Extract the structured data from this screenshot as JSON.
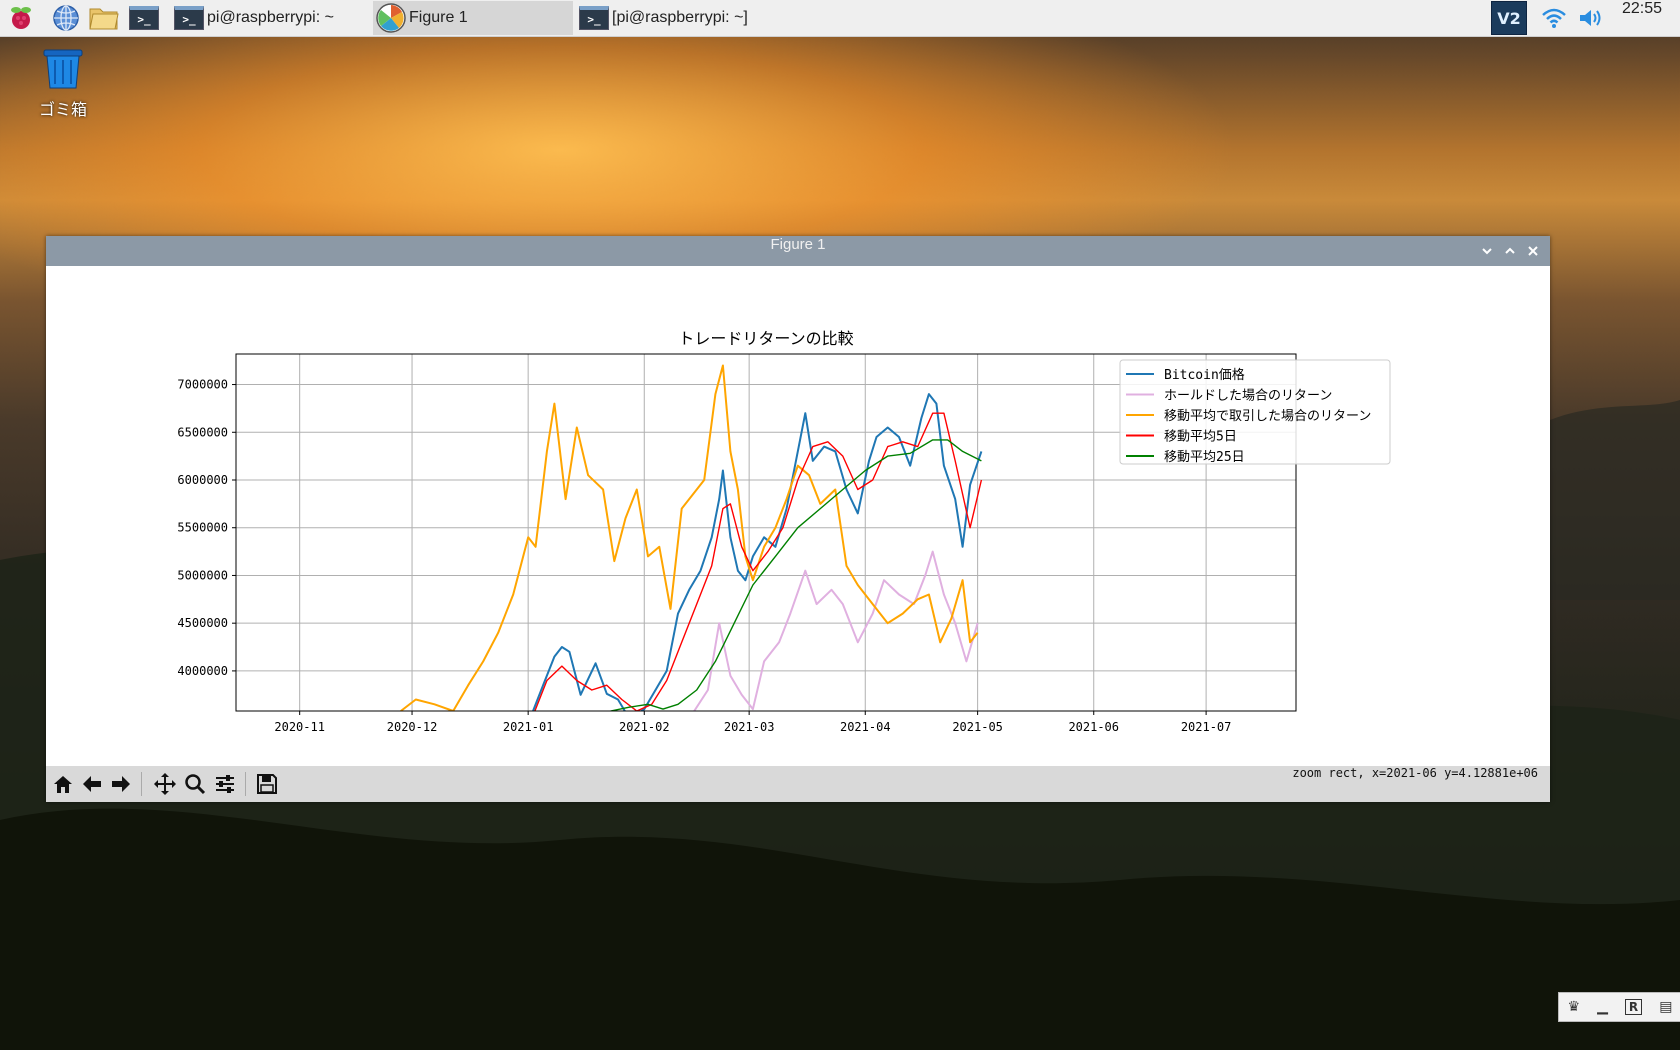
{
  "taskbar": {
    "tasks": [
      {
        "label": "pi@raspberrypi: ~"
      },
      {
        "label": "Figure 1"
      },
      {
        "label": "[pi@raspberrypi: ~]"
      }
    ],
    "clock": "22:55",
    "vnc_label": "V2"
  },
  "desktop": {
    "trash_label": "ゴミ箱"
  },
  "window": {
    "title": "Figure 1",
    "status_text": "zoom rect, x=2021-06 y=4.12881e+06"
  },
  "mini_tray": {
    "r_label": "R"
  },
  "chart_data": {
    "type": "line",
    "title": "トレードリターンの比較",
    "xlabel": "",
    "ylabel": "",
    "x_ticks": [
      "2020-11",
      "2020-12",
      "2021-01",
      "2021-02",
      "2021-03",
      "2021-04",
      "2021-05",
      "2021-06",
      "2021-07"
    ],
    "y_ticks": [
      "4000000",
      "4500000",
      "5000000",
      "5500000",
      "6000000",
      "6500000",
      "7000000"
    ],
    "ylim": [
      3580000,
      7320000
    ],
    "xlim": [
      "2020-10-15",
      "2021-07-25"
    ],
    "grid": true,
    "legend_position": "upper right",
    "series": [
      {
        "name": "Bitcoin価格",
        "color": "#1f77b4",
        "points": [
          [
            "2021-01-01",
            3450000
          ],
          [
            "2021-01-05",
            3850000
          ],
          [
            "2021-01-08",
            4150000
          ],
          [
            "2021-01-10",
            4250000
          ],
          [
            "2021-01-12",
            4200000
          ],
          [
            "2021-01-15",
            3750000
          ],
          [
            "2021-01-19",
            4080000
          ],
          [
            "2021-01-22",
            3760000
          ],
          [
            "2021-01-25",
            3700000
          ],
          [
            "2021-01-28",
            3500000
          ],
          [
            "2021-02-01",
            3600000
          ],
          [
            "2021-02-04",
            3800000
          ],
          [
            "2021-02-07",
            4000000
          ],
          [
            "2021-02-10",
            4600000
          ],
          [
            "2021-02-13",
            4850000
          ],
          [
            "2021-02-16",
            5050000
          ],
          [
            "2021-02-19",
            5400000
          ],
          [
            "2021-02-21",
            5800000
          ],
          [
            "2021-02-22",
            6100000
          ],
          [
            "2021-02-24",
            5400000
          ],
          [
            "2021-02-26",
            5050000
          ],
          [
            "2021-02-28",
            4950000
          ],
          [
            "2021-03-02",
            5200000
          ],
          [
            "2021-03-05",
            5400000
          ],
          [
            "2021-03-08",
            5300000
          ],
          [
            "2021-03-11",
            5700000
          ],
          [
            "2021-03-14",
            6300000
          ],
          [
            "2021-03-16",
            6700000
          ],
          [
            "2021-03-18",
            6200000
          ],
          [
            "2021-03-21",
            6350000
          ],
          [
            "2021-03-24",
            6300000
          ],
          [
            "2021-03-27",
            5900000
          ],
          [
            "2021-03-30",
            5650000
          ],
          [
            "2021-04-02",
            6200000
          ],
          [
            "2021-04-04",
            6450000
          ],
          [
            "2021-04-07",
            6550000
          ],
          [
            "2021-04-10",
            6450000
          ],
          [
            "2021-04-13",
            6150000
          ],
          [
            "2021-04-16",
            6650000
          ],
          [
            "2021-04-18",
            6900000
          ],
          [
            "2021-04-20",
            6800000
          ],
          [
            "2021-04-22",
            6150000
          ],
          [
            "2021-04-25",
            5800000
          ],
          [
            "2021-04-27",
            5300000
          ],
          [
            "2021-04-29",
            5950000
          ],
          [
            "2021-05-02",
            6300000
          ]
        ]
      },
      {
        "name": "ホールドした場合のリターン",
        "color": "#e0b0e0",
        "points": [
          [
            "2021-02-14",
            3560000
          ],
          [
            "2021-02-18",
            3800000
          ],
          [
            "2021-02-21",
            4500000
          ],
          [
            "2021-02-24",
            3950000
          ],
          [
            "2021-02-27",
            3750000
          ],
          [
            "2021-03-02",
            3600000
          ],
          [
            "2021-03-05",
            4100000
          ],
          [
            "2021-03-09",
            4300000
          ],
          [
            "2021-03-12",
            4600000
          ],
          [
            "2021-03-16",
            5050000
          ],
          [
            "2021-03-19",
            4700000
          ],
          [
            "2021-03-23",
            4850000
          ],
          [
            "2021-03-26",
            4700000
          ],
          [
            "2021-03-30",
            4300000
          ],
          [
            "2021-04-03",
            4600000
          ],
          [
            "2021-04-06",
            4950000
          ],
          [
            "2021-04-10",
            4800000
          ],
          [
            "2021-04-14",
            4700000
          ],
          [
            "2021-04-17",
            5000000
          ],
          [
            "2021-04-19",
            5250000
          ],
          [
            "2021-04-22",
            4800000
          ],
          [
            "2021-04-25",
            4500000
          ],
          [
            "2021-04-28",
            4100000
          ],
          [
            "2021-05-01",
            4500000
          ]
        ]
      },
      {
        "name": "移動平均で取引した場合のリターン",
        "color": "#ffa500",
        "points": [
          [
            "2020-11-28",
            3580000
          ],
          [
            "2020-12-02",
            3700000
          ],
          [
            "2020-12-07",
            3650000
          ],
          [
            "2020-12-12",
            3580000
          ],
          [
            "2020-12-16",
            3850000
          ],
          [
            "2020-12-20",
            4100000
          ],
          [
            "2020-12-24",
            4400000
          ],
          [
            "2020-12-28",
            4800000
          ],
          [
            "2021-01-01",
            5400000
          ],
          [
            "2021-01-03",
            5300000
          ],
          [
            "2021-01-06",
            6300000
          ],
          [
            "2021-01-08",
            6800000
          ],
          [
            "2021-01-11",
            5800000
          ],
          [
            "2021-01-14",
            6550000
          ],
          [
            "2021-01-17",
            6050000
          ],
          [
            "2021-01-21",
            5900000
          ],
          [
            "2021-01-24",
            5150000
          ],
          [
            "2021-01-27",
            5600000
          ],
          [
            "2021-01-30",
            5900000
          ],
          [
            "2021-02-02",
            5200000
          ],
          [
            "2021-02-05",
            5300000
          ],
          [
            "2021-02-08",
            4650000
          ],
          [
            "2021-02-11",
            5700000
          ],
          [
            "2021-02-14",
            5850000
          ],
          [
            "2021-02-17",
            6000000
          ],
          [
            "2021-02-20",
            6900000
          ],
          [
            "2021-02-22",
            7200000
          ],
          [
            "2021-02-24",
            6300000
          ],
          [
            "2021-02-26",
            5900000
          ],
          [
            "2021-02-28",
            5200000
          ],
          [
            "2021-03-02",
            4950000
          ],
          [
            "2021-03-05",
            5300000
          ],
          [
            "2021-03-08",
            5500000
          ],
          [
            "2021-03-11",
            5800000
          ],
          [
            "2021-03-14",
            6150000
          ],
          [
            "2021-03-17",
            6050000
          ],
          [
            "2021-03-20",
            5750000
          ],
          [
            "2021-03-24",
            5900000
          ],
          [
            "2021-03-27",
            5100000
          ],
          [
            "2021-03-30",
            4900000
          ],
          [
            "2021-04-03",
            4700000
          ],
          [
            "2021-04-07",
            4500000
          ],
          [
            "2021-04-11",
            4600000
          ],
          [
            "2021-04-15",
            4750000
          ],
          [
            "2021-04-18",
            4800000
          ],
          [
            "2021-04-21",
            4300000
          ],
          [
            "2021-04-24",
            4550000
          ],
          [
            "2021-04-27",
            4950000
          ],
          [
            "2021-04-29",
            4300000
          ],
          [
            "2021-05-01",
            4400000
          ]
        ]
      },
      {
        "name": "移動平均5日",
        "color": "#ff0000",
        "points": [
          [
            "2021-01-02",
            3500000
          ],
          [
            "2021-01-06",
            3900000
          ],
          [
            "2021-01-10",
            4050000
          ],
          [
            "2021-01-14",
            3900000
          ],
          [
            "2021-01-18",
            3800000
          ],
          [
            "2021-01-22",
            3850000
          ],
          [
            "2021-01-26",
            3700000
          ],
          [
            "2021-01-30",
            3580000
          ],
          [
            "2021-02-03",
            3650000
          ],
          [
            "2021-02-07",
            3900000
          ],
          [
            "2021-02-11",
            4300000
          ],
          [
            "2021-02-15",
            4700000
          ],
          [
            "2021-02-19",
            5100000
          ],
          [
            "2021-02-22",
            5700000
          ],
          [
            "2021-02-24",
            5750000
          ],
          [
            "2021-02-27",
            5300000
          ],
          [
            "2021-03-02",
            5050000
          ],
          [
            "2021-03-06",
            5250000
          ],
          [
            "2021-03-10",
            5500000
          ],
          [
            "2021-03-14",
            6000000
          ],
          [
            "2021-03-18",
            6350000
          ],
          [
            "2021-03-22",
            6400000
          ],
          [
            "2021-03-26",
            6250000
          ],
          [
            "2021-03-30",
            5900000
          ],
          [
            "2021-04-03",
            6000000
          ],
          [
            "2021-04-07",
            6350000
          ],
          [
            "2021-04-11",
            6400000
          ],
          [
            "2021-04-15",
            6350000
          ],
          [
            "2021-04-19",
            6700000
          ],
          [
            "2021-04-22",
            6700000
          ],
          [
            "2021-04-25",
            6200000
          ],
          [
            "2021-04-29",
            5500000
          ],
          [
            "2021-05-02",
            6000000
          ]
        ]
      },
      {
        "name": "移動平均25日",
        "color": "#008000",
        "points": [
          [
            "2021-01-23",
            3580000
          ],
          [
            "2021-01-28",
            3620000
          ],
          [
            "2021-02-02",
            3650000
          ],
          [
            "2021-02-06",
            3600000
          ],
          [
            "2021-02-10",
            3650000
          ],
          [
            "2021-02-15",
            3800000
          ],
          [
            "2021-02-20",
            4100000
          ],
          [
            "2021-02-25",
            4500000
          ],
          [
            "2021-03-02",
            4900000
          ],
          [
            "2021-03-08",
            5200000
          ],
          [
            "2021-03-14",
            5500000
          ],
          [
            "2021-03-20",
            5700000
          ],
          [
            "2021-03-26",
            5900000
          ],
          [
            "2021-04-01",
            6100000
          ],
          [
            "2021-04-07",
            6250000
          ],
          [
            "2021-04-13",
            6280000
          ],
          [
            "2021-04-19",
            6420000
          ],
          [
            "2021-04-23",
            6420000
          ],
          [
            "2021-04-27",
            6300000
          ],
          [
            "2021-05-02",
            6200000
          ]
        ]
      }
    ]
  }
}
